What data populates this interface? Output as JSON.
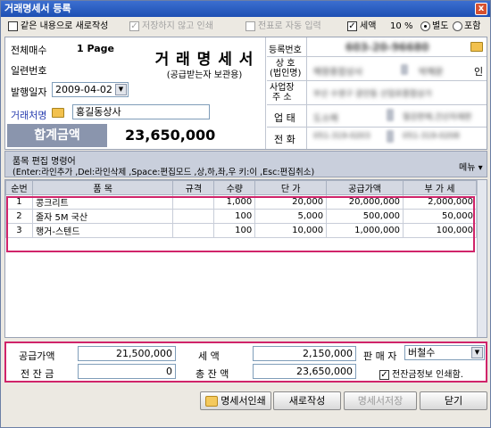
{
  "window": {
    "title": "거래명세서 등록",
    "close_glyph": "x"
  },
  "options": {
    "same_content_new": "같은 내용으로 새로작성",
    "no_print_save": "저장하지 않고 인쇄",
    "auto_supply_input": "전표로 자동 입력",
    "tax_label": "세액",
    "tax_rate": "10",
    "percent": "%",
    "separate": "별도",
    "included": "포함"
  },
  "header": {
    "total_sheets_label": "전체매수",
    "total_sheets_value": "1 Page",
    "serial_label": "일련번호",
    "issue_date_label": "발행일자",
    "issue_date_value": "2009-04-02",
    "client_label": "거래처명",
    "client_value": "홍길동상사",
    "doc_title": "거 래 명 세 서",
    "doc_subtitle": "(공급받는자 보관용)",
    "total_label": "합계금액",
    "total_value": "23,650,000"
  },
  "supplier": {
    "reg_no_label": "등록번호",
    "reg_no_value": "603-20-96680",
    "name_label": "상 호\n(법인명)",
    "name_value": "해왕종합상사",
    "rep_value": "박해운",
    "seal": "인",
    "addr_label": "사업장\n주 소",
    "addr_value": "부산 수영구 광안동 산업로종합상가",
    "biz_label": "업 태",
    "biz_value": "도소매",
    "item_value": "철강판매,건산자재판",
    "tel_label": "전 화",
    "tel_value": "051-319-0203",
    "fax_value": "051-319-0208"
  },
  "edit_help": {
    "title": "품목 편집 명령어",
    "commands": "(Enter:라인추가 ,Del:라인삭제 ,Space:편집모드 ,상,하,좌,우 키:이 ,Esc:편집취소)",
    "menu": "메뉴 ▾"
  },
  "table": {
    "headers": [
      "순번",
      "품   목",
      "규격",
      "수량",
      "단   가",
      "공급가액",
      "부 가 세"
    ],
    "rows": [
      [
        "1",
        "콩크리트",
        "",
        "1,000",
        "20,000",
        "20,000,000",
        "2,000,000"
      ],
      [
        "2",
        "줄자 5M 국산",
        "",
        "100",
        "5,000",
        "500,000",
        "50,000"
      ],
      [
        "3",
        "행거-스텐드",
        "",
        "100",
        "10,000",
        "1,000,000",
        "100,000"
      ]
    ]
  },
  "footer": {
    "supply_label": "공급가액",
    "supply_value": "21,500,000",
    "tax_label": "세   액",
    "tax_value": "2,150,000",
    "seller_label": "판 매 자",
    "seller_value": "버철수",
    "prev_balance_label": "전 잔 금",
    "prev_balance_value": "0",
    "total_label": "총 잔 액",
    "total_value": "23,650,000",
    "print_balance_label": "전잔금정보 인쇄함."
  },
  "buttons": {
    "print": "명세서인쇄",
    "new": "새로작성",
    "save": "명세서저장",
    "close": "닫기"
  }
}
